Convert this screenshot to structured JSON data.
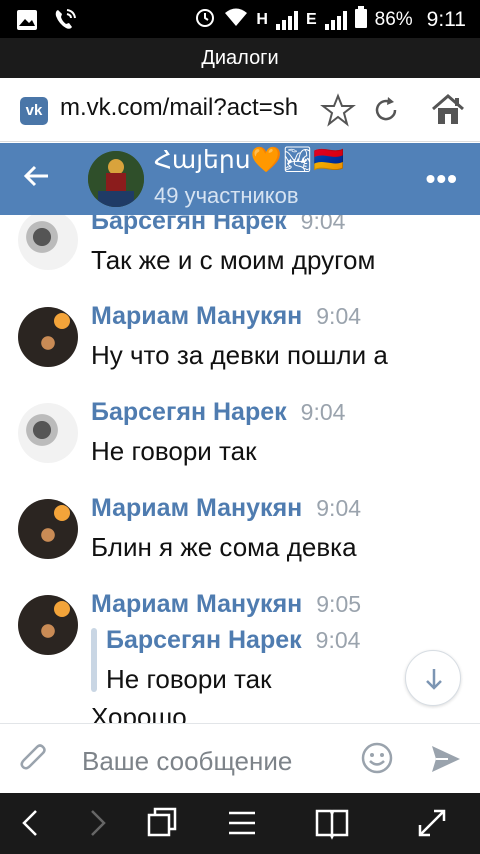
{
  "status_bar": {
    "network_letter_1": "H",
    "network_letter_2": "E",
    "battery": "86%",
    "time": "9:11"
  },
  "window_title": "Диалоги",
  "browser": {
    "url": "m.vk.com/mail?act=sh",
    "site_icon": "vk-logo-icon"
  },
  "chat_header": {
    "title": "Հայերս🧡🏞🇦🇲",
    "subtitle": "49 участников"
  },
  "messages": [
    {
      "sender": "Барсегян Нарек",
      "time": "9:04",
      "text": "Так же и с моим другом"
    },
    {
      "sender": "Мариам Манукян",
      "time": "9:04",
      "text": "Ну что за девки пошли а"
    },
    {
      "sender": "Барсегян Нарек",
      "time": "9:04",
      "text": "Не говори так"
    },
    {
      "sender": "Мариам Манукян",
      "time": "9:04",
      "text": "Блин я же сома девка"
    },
    {
      "sender": "Мариам Манукян",
      "time": "9:05",
      "text": "Хорошо",
      "quote": {
        "sender": "Барсегян Нарек",
        "time": "9:04",
        "text": "Не говори так"
      }
    }
  ],
  "composer": {
    "placeholder": "Ваше сообщение"
  },
  "colors": {
    "header_blue": "#5181b8",
    "sender_blue": "#4f7cb0"
  }
}
